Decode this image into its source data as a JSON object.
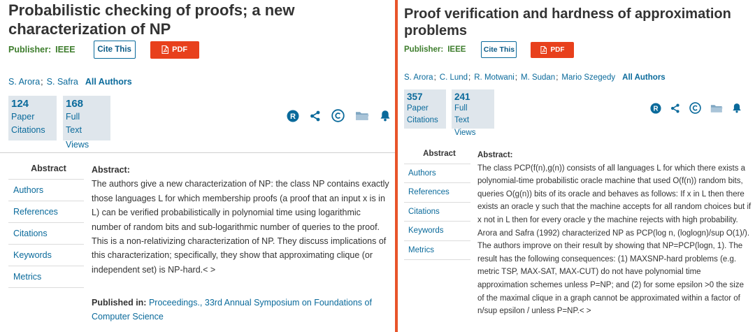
{
  "left": {
    "title": "Probabilistic checking of proofs; a new characterization of NP",
    "publisher_label": "Publisher:",
    "publisher_value": "IEEE",
    "cite_label": "Cite This",
    "pdf_label": "PDF",
    "authors": [
      "S. Arora",
      "S. Safra"
    ],
    "author_sep": ";",
    "all_authors_label": "All Authors",
    "metric1": {
      "value": "124",
      "label1": "Paper",
      "label2": "Citations"
    },
    "metric2": {
      "value": "168",
      "label1": "Full",
      "label2": "Text",
      "label3": "Views"
    },
    "nav": [
      "Abstract",
      "Authors",
      "References",
      "Citations",
      "Keywords",
      "Metrics"
    ],
    "abstract_heading": "Abstract:",
    "abstract_text": "The authors give a new characterization of NP: the class NP contains exactly those languages L for which membership proofs (a proof that an input x is in L) can be verified probabilistically in polynomial time using logarithmic number of random bits and sub-logarithmic number of queries to the proof. This is a non-relativizing characterization of NP. They discuss implications of this characterization; specifically, they show that approximating clique (or independent set) is NP-hard.< >",
    "published_in_label": "Published in:",
    "published_in_value": "Proceedings., 33rd Annual Symposium on Foundations of Computer Science"
  },
  "right": {
    "title": "Proof verification and hardness of approximation problems",
    "publisher_label": "Publisher:",
    "publisher_value": "IEEE",
    "cite_label": "Cite This",
    "pdf_label": "PDF",
    "authors": [
      "S. Arora",
      "C. Lund",
      "R. Motwani",
      "M. Sudan",
      "Mario Szegedy"
    ],
    "author_sep": ";",
    "all_authors_label": "All Authors",
    "metric1": {
      "value": "357",
      "label1": "Paper",
      "label2": "Citations"
    },
    "metric2": {
      "value": "241",
      "label1": "Full",
      "label2": "Text",
      "label3": "Views"
    },
    "nav": [
      "Abstract",
      "Authors",
      "References",
      "Citations",
      "Keywords",
      "Metrics"
    ],
    "abstract_heading": "Abstract:",
    "abstract_text": "The class PCP(f(n),g(n)) consists of all languages L for which there exists a polynomial-time probabilistic oracle machine that used O(f(n)) random bits, queries O(g(n)) bits of its oracle and behaves as follows: If x in L then there exists an oracle y such that the machine accepts for all random choices but if x not in L then for every oracle y the machine rejects with high probability. Arora and Safra (1992) characterized NP as PCP(log n, (loglogn)/sup O(1)/). The authors improve on their result by showing that NP=PCP(logn, 1). The result has the following consequences: (1) MAXSNP-hard problems (e.g. metric TSP, MAX-SAT, MAX-CUT) do not have polynomial time approximation schemes unless P=NP; and (2) for some epsilon >0 the size of the maximal clique in a graph cannot be approximated within a factor of n/sup epsilon / unless P=NP.< >"
  },
  "colors": {
    "link_blue": "#0a6a9b",
    "publisher_green": "#3d7d2c",
    "pdf_red": "#e8401c",
    "divider_orange": "#e8542a",
    "metric_bg": "#dfe6ec"
  },
  "icons": [
    "rights-r-icon",
    "share-icon",
    "copyright-icon",
    "folder-icon",
    "bell-icon",
    "pdf-file-icon"
  ]
}
